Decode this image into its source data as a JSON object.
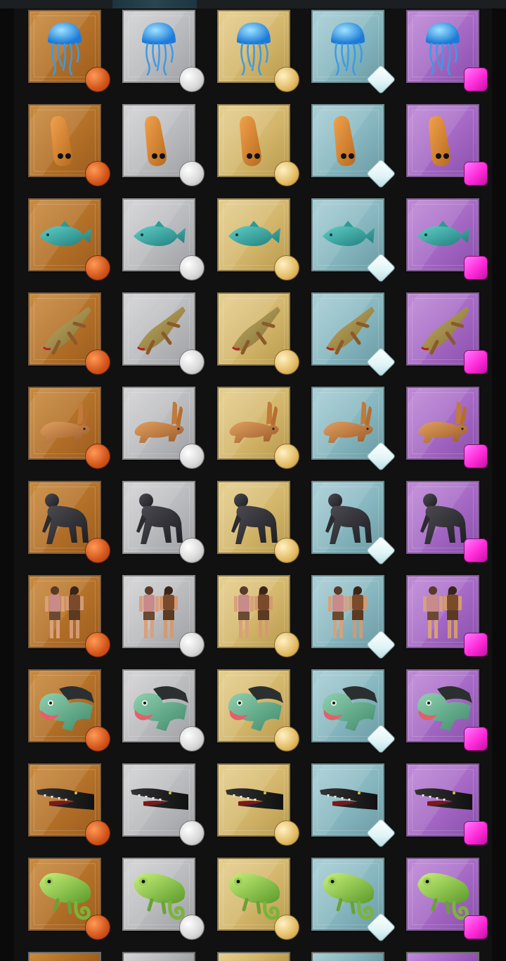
{
  "grid": {
    "tiers": [
      "bronze",
      "silver",
      "gold",
      "diamond",
      "purple"
    ],
    "rows": [
      {
        "animal": "jellyfish",
        "icon": "jellyfish-icon"
      },
      {
        "animal": "larva",
        "icon": "larva-icon"
      },
      {
        "animal": "fish",
        "icon": "fish-icon"
      },
      {
        "animal": "amphibian",
        "icon": "amphibian-icon"
      },
      {
        "animal": "rabbit",
        "icon": "rabbit-icon"
      },
      {
        "animal": "chimpanzee",
        "icon": "chimpanzee-icon"
      },
      {
        "animal": "humans",
        "icon": "humans-icon"
      },
      {
        "animal": "turtle",
        "icon": "turtle-icon"
      },
      {
        "animal": "crocodile",
        "icon": "crocodile-icon"
      },
      {
        "animal": "chameleon",
        "icon": "chameleon-icon"
      }
    ]
  },
  "colors": {
    "bronze": "#b26f27",
    "silver": "#b9babd",
    "gold": "#d3b66b",
    "diamond": "#86b6bf",
    "purple": "#a468c4",
    "background": "#111111"
  }
}
